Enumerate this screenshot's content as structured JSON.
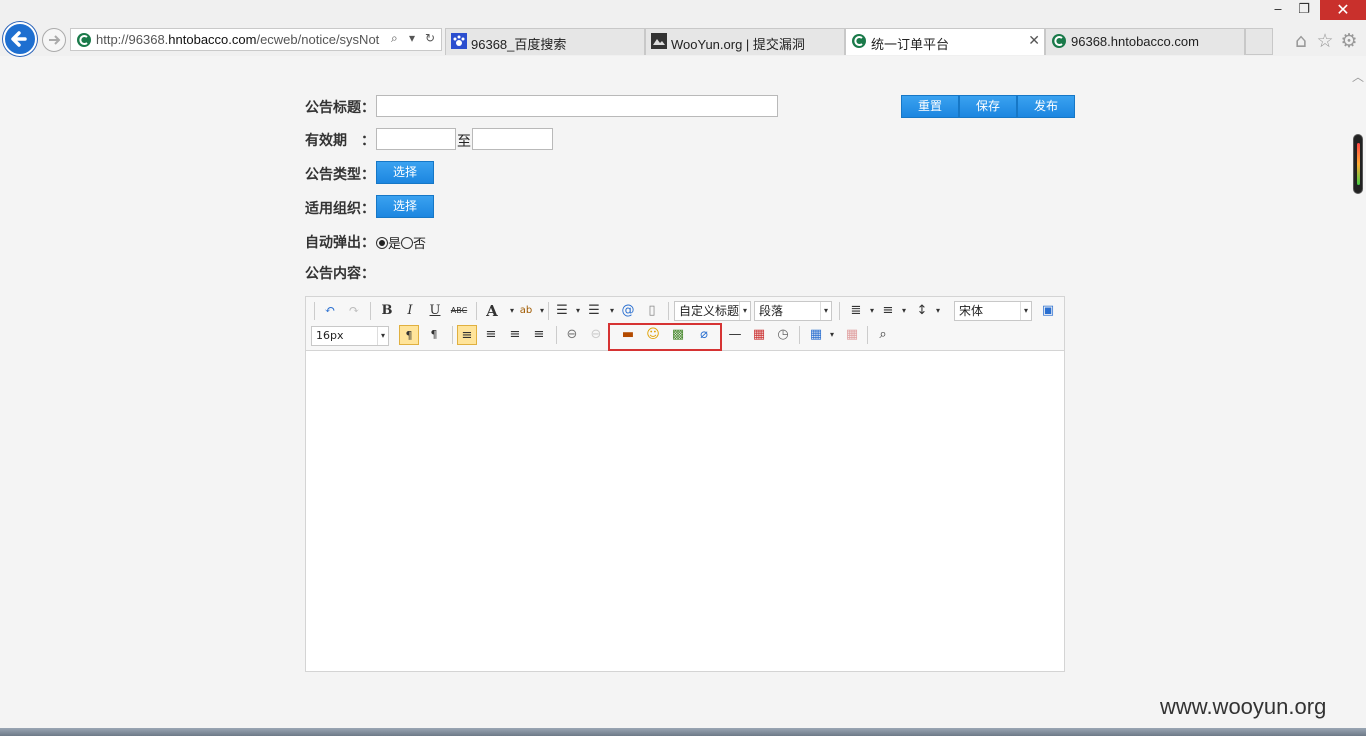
{
  "browser": {
    "window_controls": {
      "minimize": "‒",
      "maximize": "❐",
      "close": "✕"
    },
    "address": {
      "prefix": "http://96368.",
      "domain": "hntobacco.com",
      "rest": "/ecweb/notice/sysNot",
      "search_icon": "⌕",
      "dropdown": "▾",
      "refresh": "↻"
    },
    "tabs": [
      {
        "label": "96368_百度搜索",
        "icon": "paw-icon",
        "active": false
      },
      {
        "label": "WooYun.org | 提交漏洞",
        "icon": "wooyun-icon",
        "active": false
      },
      {
        "label": "统一订单平台",
        "icon": "c-logo-icon",
        "active": true,
        "close": "✕"
      },
      {
        "label": "96368.hntobacco.com",
        "icon": "c-logo-icon",
        "active": false
      }
    ],
    "icons": {
      "home": "⌂",
      "favorites": "☆",
      "settings": "⚙"
    }
  },
  "form": {
    "title_label": "公告标题：",
    "validity_label": "有效期　：",
    "to_text": "至",
    "type_label": "公告类型：",
    "org_label": "适用组织：",
    "popup_label": "自动弹出：",
    "popup_options": {
      "yes": "是",
      "no": "否",
      "selected": "yes"
    },
    "content_label": "公告内容：",
    "select_button": "选择",
    "actions": {
      "reset": "重置",
      "save": "保存",
      "publish": "发布"
    }
  },
  "editor": {
    "heading_select": "自定义标题",
    "paragraph_select": "段落",
    "font_select": "宋体",
    "size_select": "16px",
    "glyphs": {
      "bold": "B",
      "italic": "I",
      "underline": "U",
      "strike": "ABC",
      "fontcolor": "A",
      "undo": "↶",
      "redo": "↷",
      "hr": "—"
    }
  },
  "watermark": "www.wooyun.org",
  "colors": {
    "accent": "#1c86e0",
    "highlight": "#d63333"
  }
}
